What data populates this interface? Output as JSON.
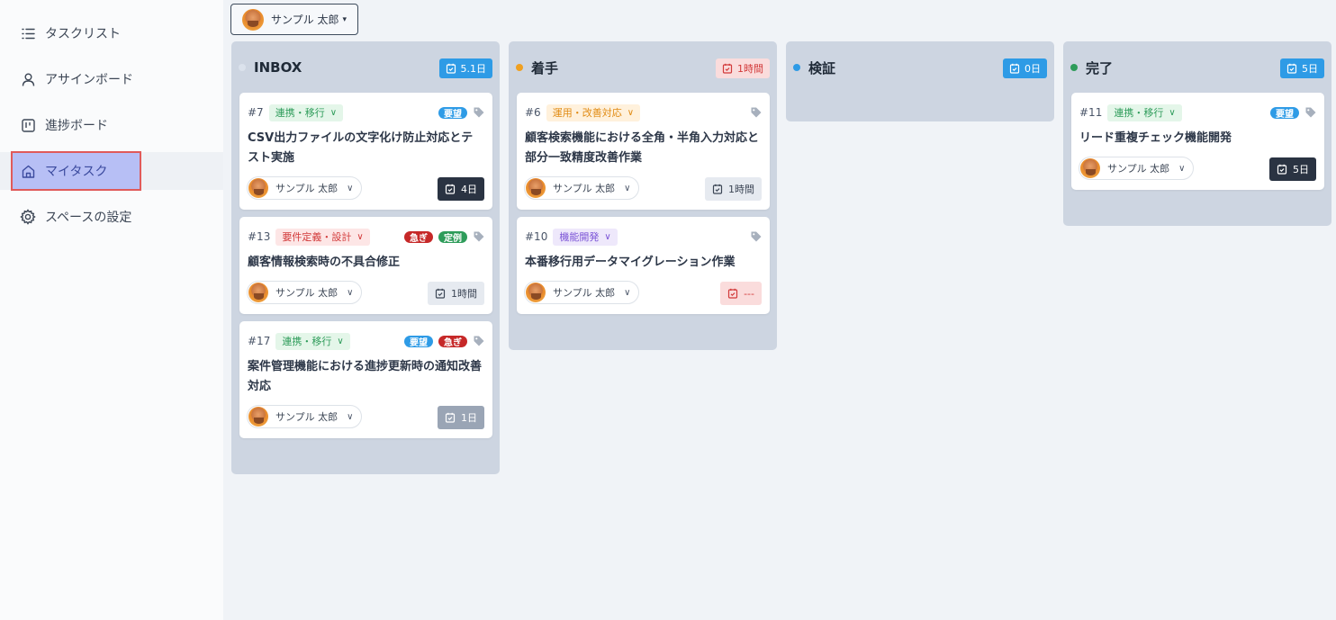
{
  "sidebar": {
    "items": [
      {
        "label": "タスクリスト",
        "icon": "list-icon"
      },
      {
        "label": "アサインボード",
        "icon": "user-icon"
      },
      {
        "label": "進捗ボード",
        "icon": "board-icon"
      },
      {
        "label": "マイタスク",
        "icon": "home-icon",
        "active": true
      },
      {
        "label": "スペースの設定",
        "icon": "gear-icon"
      }
    ]
  },
  "user_select": {
    "name": "サンプル 太郎"
  },
  "columns": [
    {
      "title": "INBOX",
      "dot_color": "#dbe2ec",
      "badge": "5.1日",
      "badge_bg": "#2e9be6",
      "badge_fg": "#ffffff",
      "cards": [
        {
          "num": "#7",
          "category": "連携・移行",
          "cat_bg": "#e4f6e9",
          "cat_fg": "#2e9c5a",
          "tags": [
            {
              "label": "要望",
              "bg": "#2e9be6"
            }
          ],
          "title": "CSV出力ファイルの文字化け防止対応とテスト実施",
          "assignee": "サンプル 太郎",
          "due": "4日",
          "due_bg": "#2a3342",
          "due_fg": "#ffffff"
        },
        {
          "num": "#13",
          "category": "要件定義・設計",
          "cat_bg": "#fde6e6",
          "cat_fg": "#d23a3a",
          "tags": [
            {
              "label": "急ぎ",
              "bg": "#c62828"
            },
            {
              "label": "定例",
              "bg": "#2e9c5a"
            }
          ],
          "title": "顧客情報検索時の不具合修正",
          "assignee": "サンプル 太郎",
          "due": "1時間",
          "due_bg": "#e6eaf0",
          "due_fg": "#3d4756"
        },
        {
          "num": "#17",
          "category": "連携・移行",
          "cat_bg": "#e4f6e9",
          "cat_fg": "#2e9c5a",
          "tags": [
            {
              "label": "要望",
              "bg": "#2e9be6"
            },
            {
              "label": "急ぎ",
              "bg": "#c62828"
            }
          ],
          "title": "案件管理機能における進捗更新時の通知改善対応",
          "assignee": "サンプル 太郎",
          "due": "1日",
          "due_bg": "#9aa5b5",
          "due_fg": "#ffffff"
        }
      ]
    },
    {
      "title": "着手",
      "dot_color": "#f0a020",
      "badge": "1時間",
      "badge_bg": "#fadcdc",
      "badge_fg": "#d23a3a",
      "cards": [
        {
          "num": "#6",
          "category": "運用・改善対応",
          "cat_bg": "#fff1dc",
          "cat_fg": "#e08a12",
          "tags": [],
          "title": "顧客検索機能における全角・半角入力対応と部分一致精度改善作業",
          "assignee": "サンプル 太郎",
          "due": "1時間",
          "due_bg": "#e6eaf0",
          "due_fg": "#3d4756"
        },
        {
          "num": "#10",
          "category": "機能開発",
          "cat_bg": "#eee8fb",
          "cat_fg": "#7a52d6",
          "tags": [],
          "title": "本番移行用データマイグレーション作業",
          "assignee": "サンプル 太郎",
          "due": "---",
          "due_bg": "#fadcdc",
          "due_fg": "#d23a3a"
        }
      ]
    },
    {
      "title": "検証",
      "dot_color": "#2e9be6",
      "badge": "0日",
      "badge_bg": "#2e9be6",
      "badge_fg": "#ffffff",
      "cards": []
    },
    {
      "title": "完了",
      "dot_color": "#2e9c5a",
      "badge": "5日",
      "badge_bg": "#2e9be6",
      "badge_fg": "#ffffff",
      "cards": [
        {
          "num": "#11",
          "category": "連携・移行",
          "cat_bg": "#e4f6e9",
          "cat_fg": "#2e9c5a",
          "tags": [
            {
              "label": "要望",
              "bg": "#2e9be6"
            }
          ],
          "title": "リード重複チェック機能開発",
          "assignee": "サンプル 太郎",
          "due": "5日",
          "due_bg": "#2a3342",
          "due_fg": "#ffffff"
        }
      ]
    }
  ]
}
